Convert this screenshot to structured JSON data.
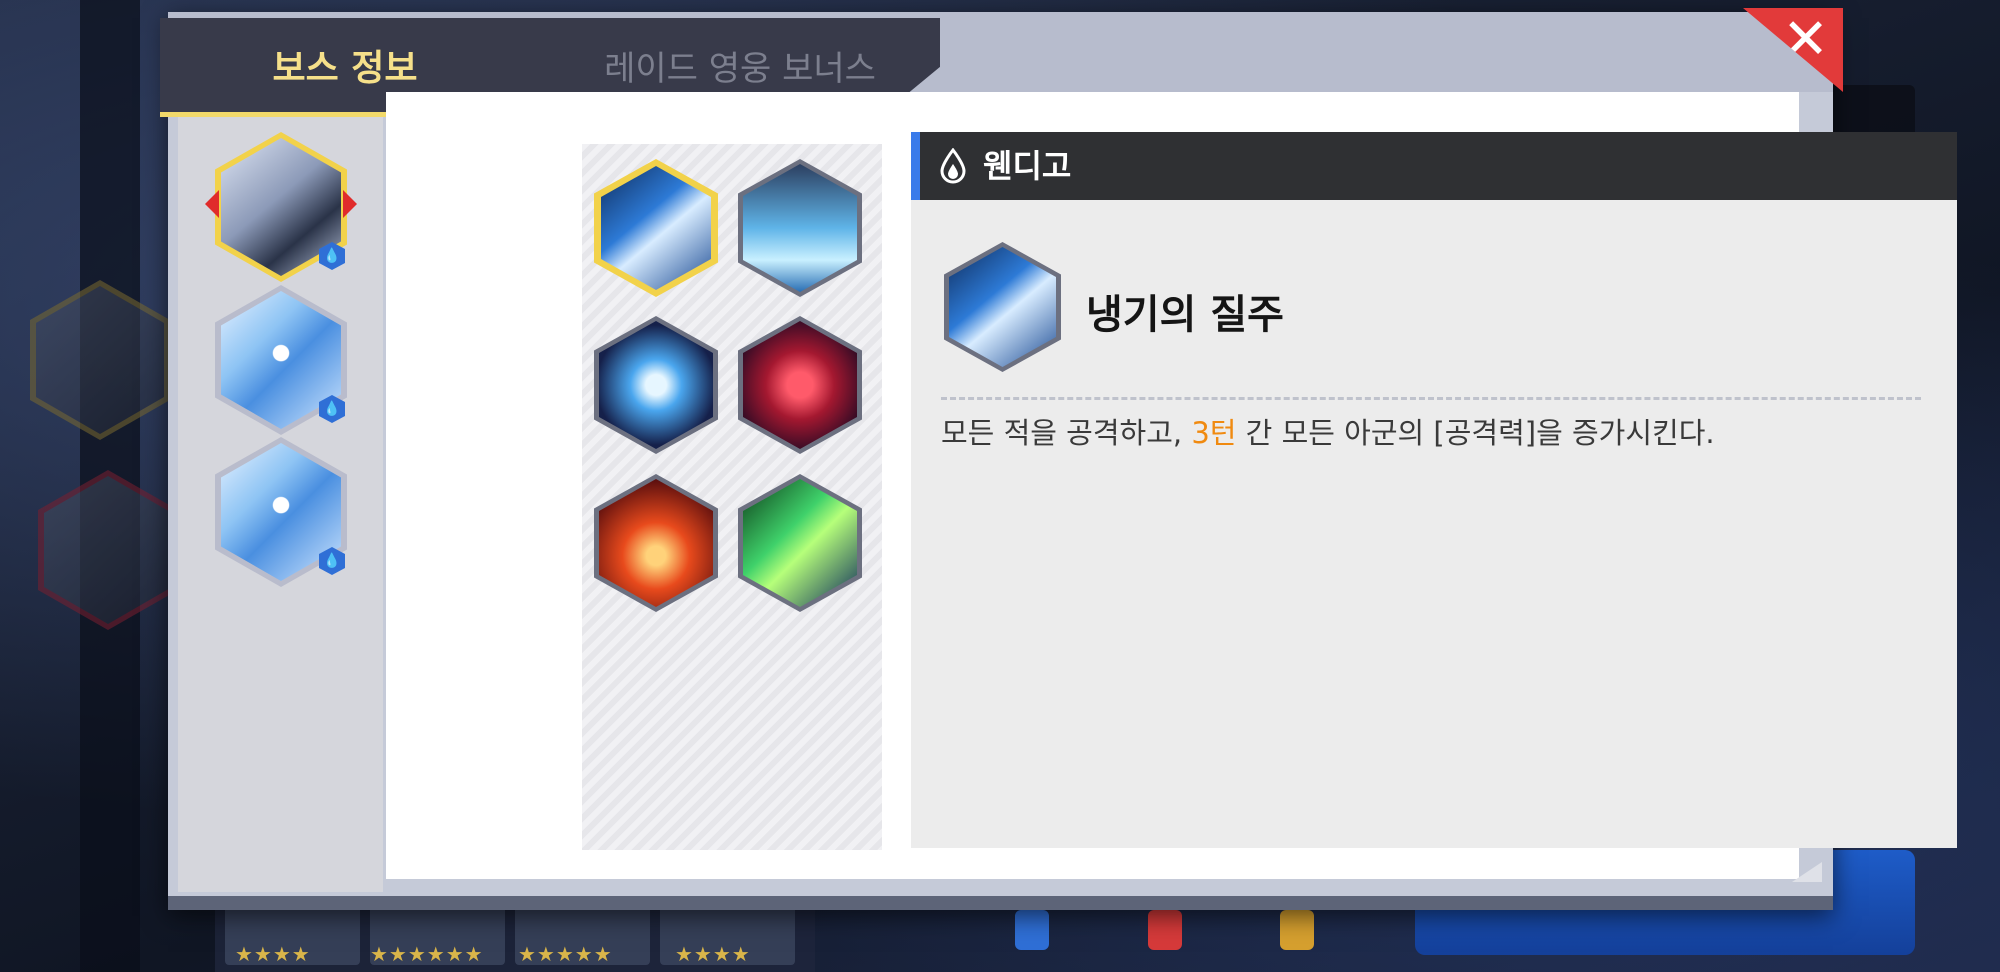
{
  "tabs": [
    {
      "label": "보스 정보",
      "active": true
    },
    {
      "label": "레이드 영웅 보너스",
      "active": false
    }
  ],
  "close_label": "✕",
  "bosses": [
    {
      "name": "boss-1",
      "selected": true,
      "element": "water"
    },
    {
      "name": "boss-2",
      "selected": false,
      "element": "water"
    },
    {
      "name": "boss-3",
      "selected": false,
      "element": "water"
    }
  ],
  "element_badge_glyph": "💧",
  "skills": [
    {
      "icon": "ice-claw-skill",
      "selected": true
    },
    {
      "icon": "ice-crystal-skill",
      "selected": false
    },
    {
      "icon": "frost-burst-skill",
      "selected": false
    },
    {
      "icon": "red-vortex-skill",
      "selected": false
    },
    {
      "icon": "fire-burst-skill",
      "selected": false
    },
    {
      "icon": "poison-slash-skill",
      "selected": false
    }
  ],
  "detail": {
    "boss_name": "웬디고",
    "element_icon": "water-drop-icon",
    "skill_name": "냉기의 질주",
    "description_before": "모든 적을 공격하고, ",
    "description_highlight": "3턴",
    "description_after": " 간 모든 아군의 [공격력]을 증가시킨다."
  },
  "colors": {
    "accent_gold": "#f2d24a",
    "tab_active_text": "#f6e08a",
    "header_accent_blue": "#3a7bea",
    "highlight_orange": "#f08a10",
    "close_red": "#e23a3a"
  },
  "background": {
    "stars": [
      "★★★★",
      "★★★★★★",
      "★★★★★",
      "★★★★"
    ]
  }
}
